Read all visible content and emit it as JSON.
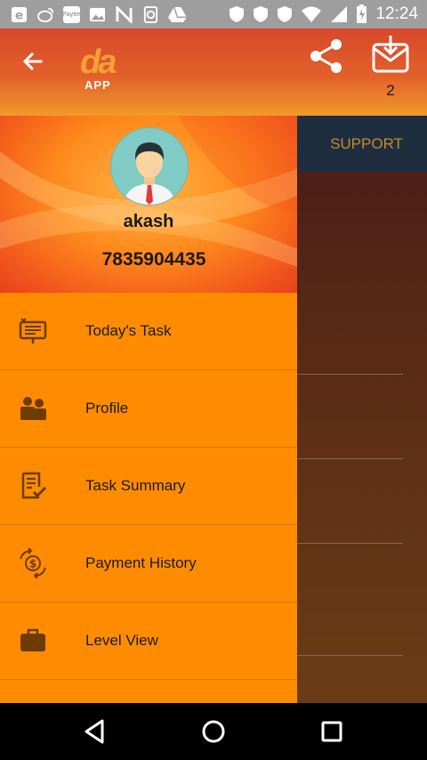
{
  "status_bar": {
    "time": "12:24",
    "icons": [
      "ie-icon",
      "weibo-icon",
      "paytm-icon",
      "image-icon",
      "n-icon",
      "refresh-box-icon",
      "drive-icon",
      "shield-icon",
      "shield-icon",
      "shield-icon",
      "wifi-icon",
      "signal-icon",
      "battery-charging-icon"
    ],
    "paytm_text": "Paytm"
  },
  "app_bar": {
    "logo_text": "da",
    "logo_sub": "APP",
    "mail_count": "2"
  },
  "background": {
    "support_label": "SUPPORT"
  },
  "drawer": {
    "user": {
      "name": "akash",
      "phone": "7835904435"
    },
    "menu": [
      {
        "label": "Today's Task",
        "icon": "task-board-icon"
      },
      {
        "label": "Profile",
        "icon": "people-icon"
      },
      {
        "label": "Task Summary",
        "icon": "checklist-icon"
      },
      {
        "label": "Payment History",
        "icon": "dollar-exchange-icon"
      },
      {
        "label": "Level View",
        "icon": "briefcase-icon"
      }
    ]
  },
  "colors": {
    "drawer": "#ff8c00",
    "app_bar": "#e2602b",
    "support_tab": "#1f2e3e"
  }
}
